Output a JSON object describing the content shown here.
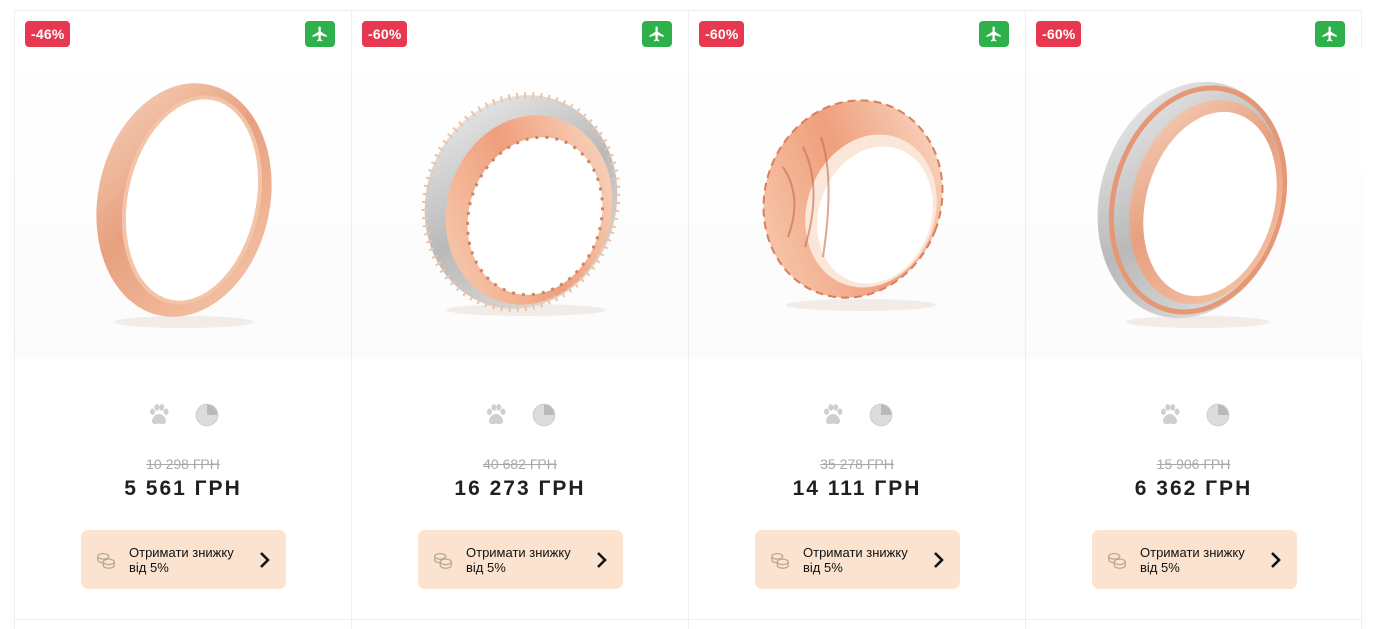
{
  "colors": {
    "discount_badge": "#e8384f",
    "delivery_badge": "#2eb14a",
    "cta_background": "#fbe3cf",
    "price": "#231f1f",
    "old_price": "#a8a8a8",
    "feature_icon": "#cfcfcf"
  },
  "products": [
    {
      "discount": "-46%",
      "old_price": "10 298 ГРН",
      "price": "5 561 ГРН",
      "cta_line1": "Отримати знижку",
      "cta_line2": "від 5%",
      "icons": [
        "airplane-icon",
        "paw-icon",
        "pie-chart-icon",
        "coins-icon",
        "chevron-right-icon"
      ]
    },
    {
      "discount": "-60%",
      "old_price": "40 682 ГРН",
      "price": "16 273 ГРН",
      "cta_line1": "Отримати знижку",
      "cta_line2": "від 5%",
      "icons": [
        "airplane-icon",
        "paw-icon",
        "pie-chart-icon",
        "coins-icon",
        "chevron-right-icon"
      ]
    },
    {
      "discount": "-60%",
      "old_price": "35 278 ГРН",
      "price": "14 111 ГРН",
      "cta_line1": "Отримати знижку",
      "cta_line2": "від 5%",
      "icons": [
        "airplane-icon",
        "paw-icon",
        "pie-chart-icon",
        "coins-icon",
        "chevron-right-icon"
      ]
    },
    {
      "discount": "-60%",
      "old_price": "15 906 ГРН",
      "price": "6 362 ГРН",
      "cta_line1": "Отримати знижку",
      "cta_line2": "від 5%",
      "icons": [
        "airplane-icon",
        "paw-icon",
        "pie-chart-icon",
        "coins-icon",
        "chevron-right-icon"
      ]
    }
  ]
}
